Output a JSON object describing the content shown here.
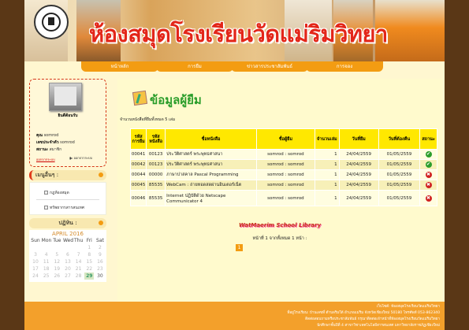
{
  "header": {
    "school_name": "ห้องสมุดโรงเรียนวัดแม่ริมวิทยา"
  },
  "nav": {
    "items": [
      {
        "label": "หน้าหลัก"
      },
      {
        "label": "การยืม"
      },
      {
        "label": "ข่าวสารประชาสัมพันธ์"
      },
      {
        "label": "การจอง"
      }
    ]
  },
  "user": {
    "avatar_caption": "ยินดีต้อนรับ",
    "name_label": "คุณ",
    "name_value": "somrod",
    "id_label": "เลขประจำตัว",
    "id_value": "somrod",
    "status_label": "สถานะ",
    "status_value": "สมาชิก",
    "logout_label": "ออกจากระบบ",
    "logout_icon_label": "ออกจากระบบ"
  },
  "main_menu": {
    "title": "เมนูอื่นๆ :",
    "items": [
      {
        "label": "กฎห้องสมุด"
      },
      {
        "label": "ทรัพยากรสารสนเทศ"
      }
    ]
  },
  "calendar": {
    "title": "ปฏิทิน :",
    "month": "APRIL 2016",
    "days_of_week": [
      "Sun",
      "Mon",
      "Tue",
      "Wed",
      "Thu",
      "Fri",
      "Sat"
    ],
    "weeks": [
      [
        "",
        "",
        "",
        "",
        "",
        "1",
        "2"
      ],
      [
        "3",
        "4",
        "5",
        "6",
        "7",
        "8",
        "9"
      ],
      [
        "10",
        "11",
        "12",
        "13",
        "14",
        "15",
        "16"
      ],
      [
        "17",
        "18",
        "19",
        "20",
        "21",
        "22",
        "23"
      ],
      [
        "24",
        "25",
        "26",
        "27",
        "28",
        "29",
        "30"
      ]
    ],
    "today": "29"
  },
  "main": {
    "title": "ข้อมูลผู้ยืม",
    "summary": "จำนวนหนังสือที่ยืมทั้งหมด 5 เล่ม",
    "columns": [
      "รหัสการยืม",
      "รหัสหนังสือ",
      "ชื่อหนังสือ",
      "ชื่อผู้ยืม",
      "จำนวนเล่ม",
      "วันที่ยืม",
      "วันที่ต้องคืน",
      "สถานะ"
    ],
    "rows": [
      {
        "loan_id": "00041",
        "book_id": "00123",
        "title": "ประวัติศาสตร์ พระพุทธศาสนา",
        "borrower": "somrod : somrod",
        "qty": "1",
        "borrow_date": "24/04/2559",
        "due_date": "01/05/2559",
        "status": "ok"
      },
      {
        "loan_id": "00042",
        "book_id": "00123",
        "title": "ประวัติศาสตร์ พระพุทธศาสนา",
        "borrower": "somrod : somrod",
        "qty": "1",
        "borrow_date": "24/04/2559",
        "due_date": "01/05/2559",
        "status": "ok"
      },
      {
        "loan_id": "00044",
        "book_id": "00000",
        "title": "ภาษาปาสคาล Pascal Programming",
        "borrower": "somrod : somrod",
        "qty": "1",
        "borrow_date": "24/04/2559",
        "due_date": "01/05/2559",
        "status": "late"
      },
      {
        "loan_id": "00045",
        "book_id": "85535",
        "title": "WebCam : ถ่ายทอดสดผ่านอินเตอร์เน็ต",
        "borrower": "somrod : somrod",
        "qty": "1",
        "borrow_date": "24/04/2559",
        "due_date": "01/05/2559",
        "status": "late"
      },
      {
        "loan_id": "00046",
        "book_id": "85535",
        "title": "Internet ปฏิบัติด้วย Netscape Communicator 4",
        "borrower": "somrod : somrod",
        "qty": "1",
        "borrow_date": "24/04/2559",
        "due_date": "01/05/2559",
        "status": "late"
      }
    ],
    "library_name": "WatMaerim School Library",
    "page_info": "หน้าที่ 1 จากทั้งหมด 1 หน้า :",
    "current_page": "1"
  },
  "footer": {
    "lines": [
      "เว็บไซต์: ห้องสมุดโรงเรียนวัดแม่ริมวิทยา",
      "ที่อยู่โรงเรียน: บ้านเลขที่ ตำบลริมใต้ อำเภอแม่ริม จังหวัดเชียงใหม่ 50180 โทรศัพท์ 053-862340",
      "ติดต่อสอบถามหรือประชาสัมพันธ์ กรุณาติดต่อเจ้าหน้าที่ห้องสมุดโรงเรียนวัดแม่ริมวิทยา",
      "นักศึกษาชั้นปีที่ 4 สาขาวิชาเทคโนโลยีสารสนเทศ มหาวิทยาลัยราชภัฏเชียงใหม่"
    ]
  },
  "colors": {
    "accent": "#f39c12",
    "title_green": "#2a9d2a",
    "header_red": "#e32619",
    "table_header": "#ffe800",
    "status_ok": "#2c9e2c",
    "status_late": "#d02121"
  }
}
